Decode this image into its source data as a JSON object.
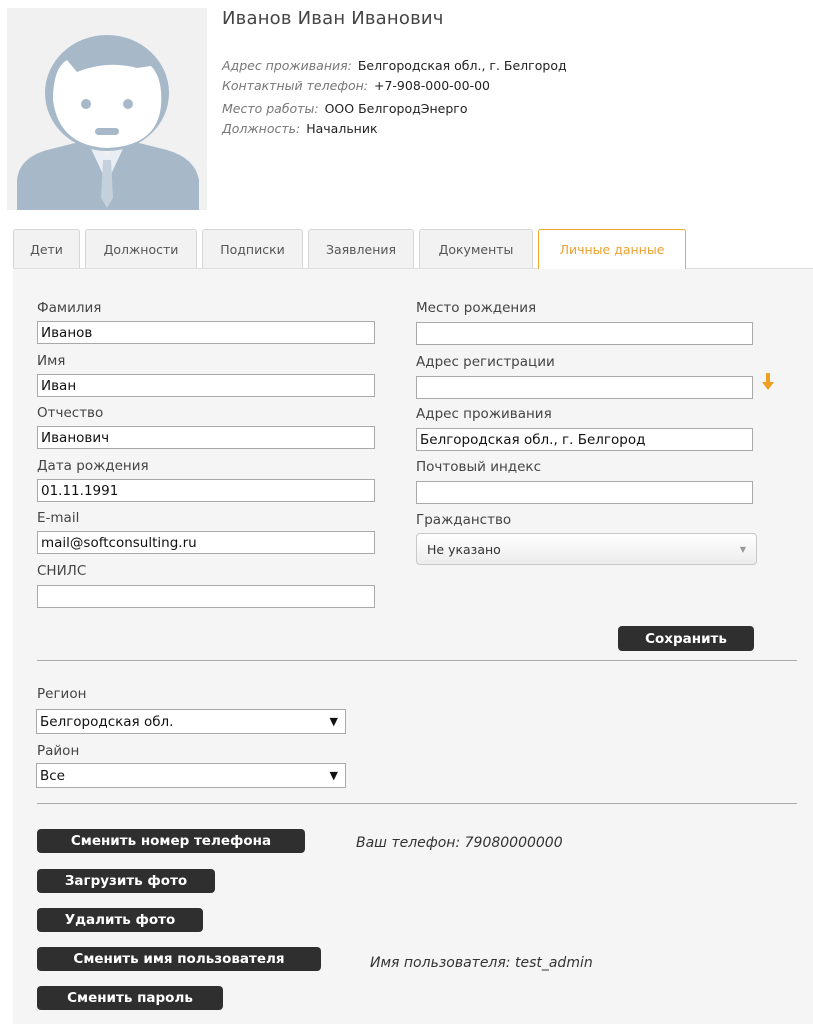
{
  "profile": {
    "full_name": "Иванов Иван Иванович",
    "info": [
      {
        "label": "Адрес проживания:",
        "value": "Белгородская обл., г. Белгород"
      },
      {
        "label": "Контактный телефон:",
        "value": "+7-908-000-00-00"
      },
      {
        "label": "Место работы:",
        "value": "ООО БелгородЭнерго"
      },
      {
        "label": "Должность:",
        "value": "Начальник"
      }
    ]
  },
  "tabs": [
    "Дети",
    "Должности",
    "Подписки",
    "Заявления",
    "Документы",
    "Личные данные"
  ],
  "active_tab": "Личные данные",
  "form": {
    "last_name": {
      "label": "Фамилия",
      "value": "Иванов"
    },
    "first_name": {
      "label": "Имя",
      "value": "Иван"
    },
    "patronymic": {
      "label": "Отчество",
      "value": "Иванович"
    },
    "birth_date": {
      "label": "Дата рождения",
      "value": "01.11.1991"
    },
    "email": {
      "label": "E-mail",
      "value": "mail@softconsulting.ru"
    },
    "snils": {
      "label": "СНИЛС",
      "value": ""
    },
    "birth_place": {
      "label": "Место рождения",
      "value": ""
    },
    "reg_address": {
      "label": "Адрес регистрации",
      "value": ""
    },
    "live_address": {
      "label": "Адрес проживания",
      "value": "Белгородская обл., г. Белгород"
    },
    "postal_code": {
      "label": "Почтовый индекс",
      "value": ""
    },
    "citizenship": {
      "label": "Гражданство",
      "value": "Не указано"
    },
    "save_label": "Сохранить"
  },
  "location": {
    "region": {
      "label": "Регион",
      "value": "Белгородская обл."
    },
    "district": {
      "label": "Район",
      "value": "Все"
    }
  },
  "actions": {
    "change_phone": "Сменить номер телефона",
    "phone_note": "Ваш телефон: 79080000000",
    "upload_photo": "Загрузить фото",
    "delete_photo": "Удалить фото",
    "change_username": "Сменить имя пользователя",
    "username_note": "Имя пользователя: test_admin",
    "change_password": "Сменить пароль"
  },
  "colors": {
    "active_tab": "#f0a030",
    "button_bg": "#2f2f2f",
    "avatar": "#a7b8c8",
    "arrow_icon": "#f0a020"
  },
  "icons": [
    "avatar-silhouette",
    "down-arrow-icon",
    "chevron-down-icon"
  ]
}
